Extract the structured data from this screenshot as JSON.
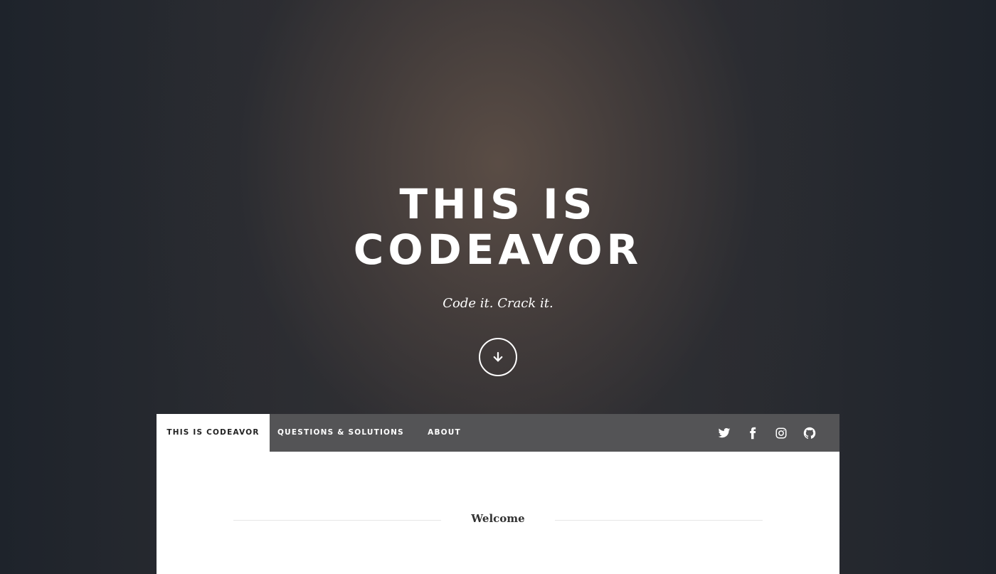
{
  "hero": {
    "title_line1": "THIS IS",
    "title_line2": "CODEAVOR",
    "tagline": "Code it. Crack it.",
    "scroll_icon": "arrow-down-icon"
  },
  "nav": {
    "tabs": [
      {
        "label": "THIS IS CODEAVOR",
        "active": true
      },
      {
        "label": "QUESTIONS & SOLUTIONS",
        "active": false
      },
      {
        "label": "ABOUT",
        "active": false
      }
    ],
    "social": [
      "twitter-icon",
      "facebook-icon",
      "instagram-icon",
      "github-icon"
    ]
  },
  "main": {
    "section_heading": "Welcome"
  },
  "colors": {
    "nav_bg": "#545456",
    "active_tab_bg": "#ffffff",
    "page_bg": "#1f242c",
    "text_light": "#ffffff"
  }
}
